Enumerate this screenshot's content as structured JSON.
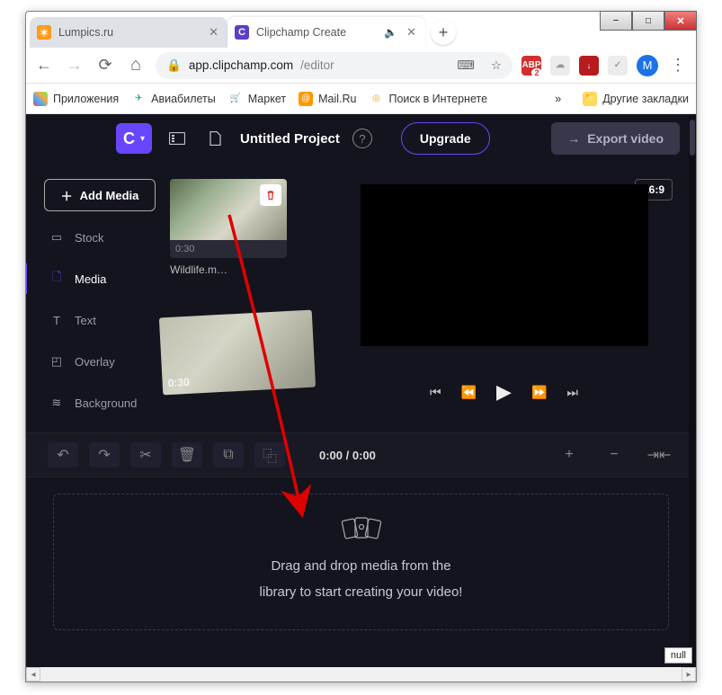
{
  "browser": {
    "tabs": [
      {
        "title": "Lumpics.ru",
        "favicon_letter": ""
      },
      {
        "title": "Clipchamp Create",
        "favicon_letter": "C",
        "audio": true
      }
    ],
    "url_prefix": "app.clipchamp.com",
    "url_suffix": "/editor",
    "avatar_letter": "M",
    "bookmarks": {
      "apps": "Приложения",
      "avia": "Авиабилеты",
      "market": "Маркет",
      "mailru": "Mail.Ru",
      "search": "Поиск в Интернете",
      "more": "»",
      "other": "Другие закладки"
    }
  },
  "clipchamp": {
    "brand_letter": "C",
    "project_title": "Untitled Project",
    "upgrade_label": "Upgrade",
    "export_label": "Export video",
    "aspect": "16:9",
    "add_media_label": "Add Media",
    "sidebar": [
      {
        "label": "Stock"
      },
      {
        "label": "Media"
      },
      {
        "label": "Text"
      },
      {
        "label": "Overlay"
      },
      {
        "label": "Background"
      }
    ],
    "media_item": {
      "duration": "0:30",
      "name": "Wildlife.m…"
    },
    "drag_ghost_duration": "0:30",
    "timecode": "0:00 / 0:00",
    "dropzone_line1": "Drag and drop media from the",
    "dropzone_line2": "library to start creating your video!",
    "null_text": "null"
  }
}
